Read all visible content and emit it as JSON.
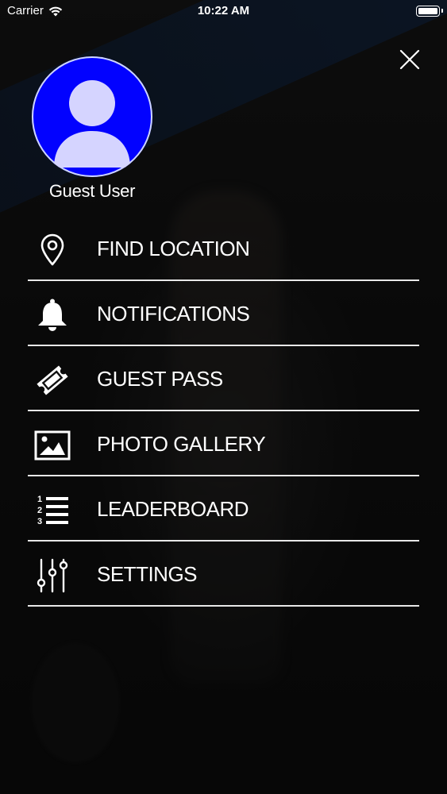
{
  "status_bar": {
    "carrier": "Carrier",
    "time": "10:22 AM"
  },
  "user": {
    "name": "Guest User",
    "avatar_color": "#0202FF"
  },
  "menu": {
    "items": [
      {
        "label": "FIND LOCATION",
        "icon": "location-pin-icon"
      },
      {
        "label": "NOTIFICATIONS",
        "icon": "bell-icon"
      },
      {
        "label": "GUEST PASS",
        "icon": "ticket-icon"
      },
      {
        "label": "PHOTO GALLERY",
        "icon": "image-icon"
      },
      {
        "label": "LEADERBOARD",
        "icon": "numbered-list-icon"
      },
      {
        "label": "SETTINGS",
        "icon": "sliders-icon"
      }
    ]
  },
  "colors": {
    "text": "#FFFFFF",
    "divider": "#E8E8E8"
  }
}
